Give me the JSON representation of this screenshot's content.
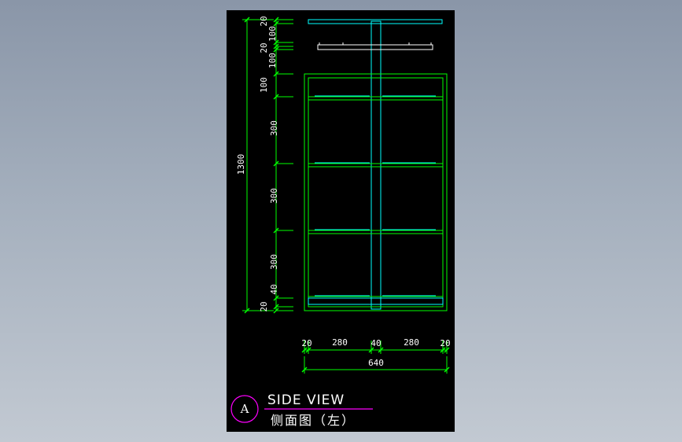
{
  "view": {
    "badge_letter": "A",
    "title_en": "SIDE VIEW",
    "title_cn": "侧面图（左）"
  },
  "dimensions": {
    "vertical": [
      "20",
      "100",
      "20",
      "100",
      "100",
      "300",
      "300",
      "300",
      "40",
      "20"
    ],
    "vertical_total": "1300",
    "horizontal": [
      "20",
      "280",
      "40",
      "280",
      "20"
    ],
    "horizontal_total": "640"
  },
  "colors": {
    "frame": "#00ff00",
    "cyan": "#00ffff",
    "white": "#ffffff",
    "badge": "#ff00ff",
    "dim": "#00ff00"
  }
}
